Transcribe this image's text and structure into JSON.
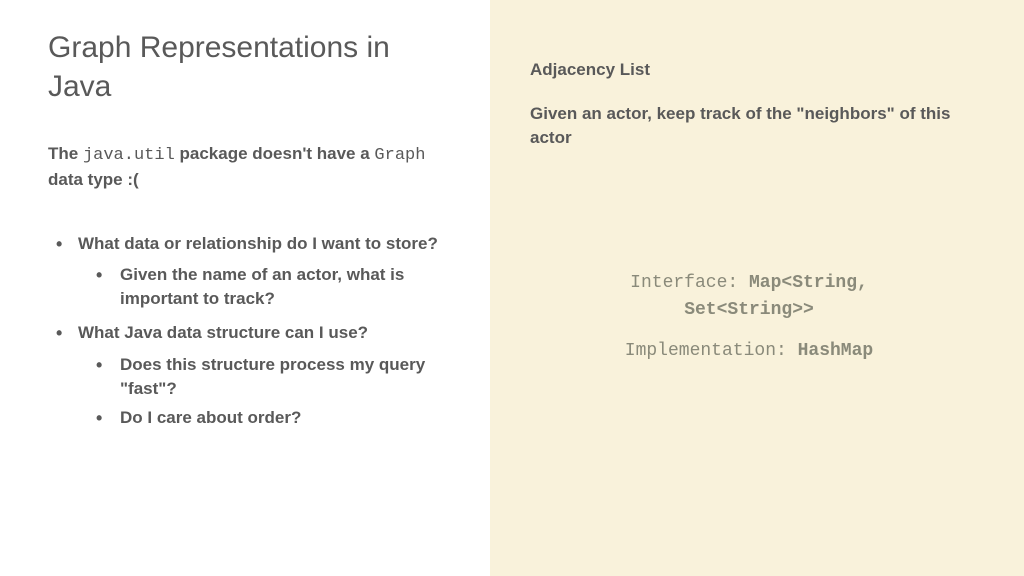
{
  "left": {
    "title": "Graph Representations in Java",
    "subtitle_pre": "The ",
    "subtitle_code1": "java.util",
    "subtitle_mid": " package doesn't have a ",
    "subtitle_code2": "Graph",
    "subtitle_post": " data type :(",
    "bullets": {
      "b1": "What data or relationship do I want to store?",
      "b1a": "Given the name of an actor, what is important to track?",
      "b2": "What Java data structure can I use?",
      "b2a": "Does this structure process my query \"fast\"?",
      "b2b": "Do I care about order?"
    }
  },
  "right": {
    "heading": "Adjacency List",
    "subheading": "Given an actor, keep track of the \"neighbors\" of this actor",
    "interface_label": "Interface: ",
    "interface_type_line1": "Map<String,",
    "interface_type_line2": "Set<String>>",
    "impl_label": "Implementation: ",
    "impl_type": "HashMap"
  }
}
